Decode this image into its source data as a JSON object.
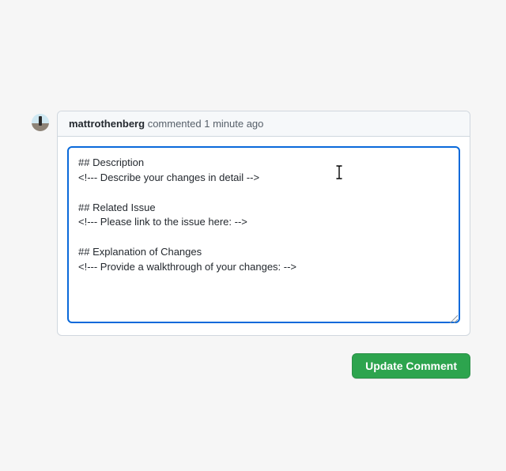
{
  "comment": {
    "author": "mattrothenberg",
    "verb": "commented",
    "timestamp": "1 minute ago",
    "body": "## Description\n<!--- Describe your changes in detail -->\n\n## Related Issue\n<!--- Please link to the issue here: -->\n\n## Explanation of Changes\n<!--- Provide a walkthrough of your changes: -->"
  },
  "actions": {
    "update_label": "Update Comment"
  },
  "colors": {
    "focus_ring": "#0969da",
    "primary_btn": "#2da44e"
  }
}
